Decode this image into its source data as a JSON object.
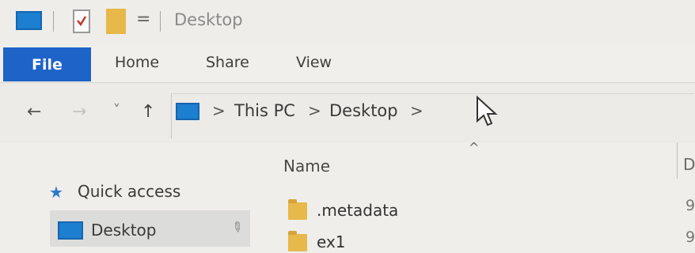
{
  "window": {
    "title": "Desktop"
  },
  "quick_access_toolbar": {
    "dropdown_glyph": "="
  },
  "ribbon": {
    "tabs": [
      {
        "label": "File"
      },
      {
        "label": "Home"
      },
      {
        "label": "Share"
      },
      {
        "label": "View"
      }
    ]
  },
  "nav": {
    "back": "←",
    "forward": "→",
    "recent": "˅",
    "up": "↑"
  },
  "address_bar": {
    "crumbs": [
      "This PC",
      "Desktop"
    ],
    "separator": ">"
  },
  "file_list": {
    "sort_indicator": "^",
    "columns": {
      "name": "Name",
      "next_partial": "D"
    },
    "items": [
      {
        "name": ".metadata",
        "cut_column": "9"
      },
      {
        "name": "ex1",
        "cut_column": "9"
      }
    ]
  },
  "nav_pane": {
    "items": [
      {
        "label": "Quick access"
      },
      {
        "label": "Desktop"
      }
    ]
  },
  "colors": {
    "file_tab": "#1e63c8",
    "folder": "#e7b84a",
    "pc_icon": "#1c7fd0",
    "star": "#2a79c9"
  }
}
